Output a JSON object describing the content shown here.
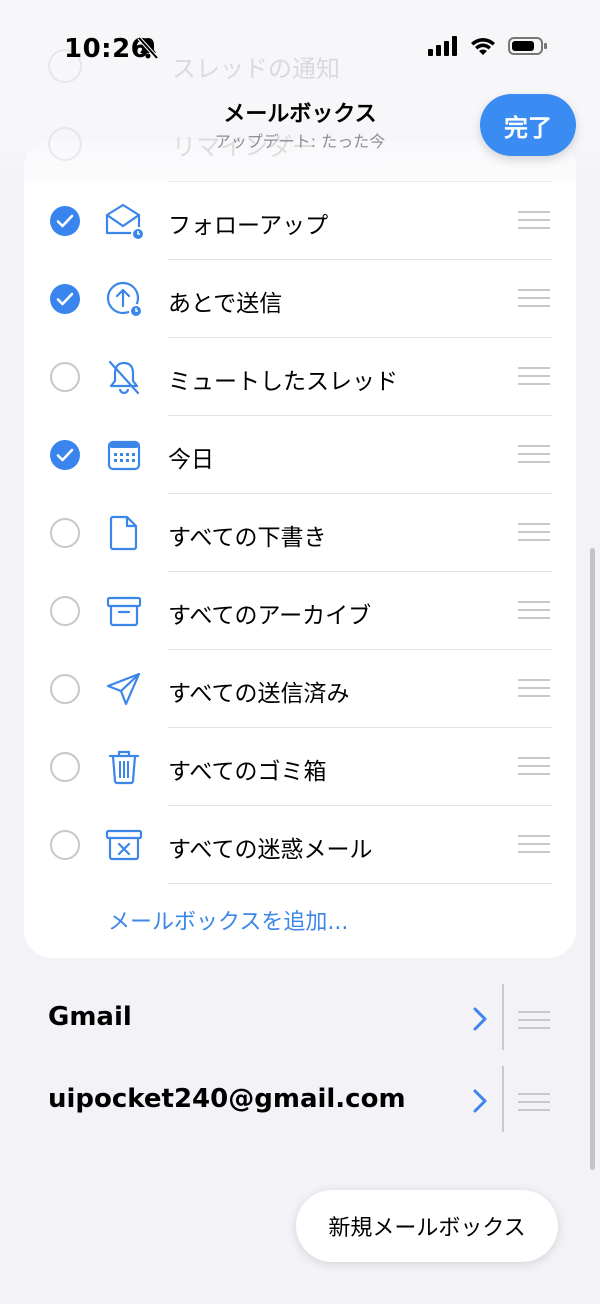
{
  "status": {
    "time": "10:26"
  },
  "header": {
    "title": "メールボックス",
    "subtitle": "アップデート: たった今",
    "done_label": "完了",
    "ghost_items": [
      "スレッドの通知",
      "リマインダー"
    ]
  },
  "colors": {
    "accent": "#3b8cf2",
    "check": "#3a84ee",
    "bg": "#f2f2f7"
  },
  "mailboxes": [
    {
      "label": "フォローアップ",
      "checked": true,
      "icon": "envelope-clock-icon"
    },
    {
      "label": "あとで送信",
      "checked": true,
      "icon": "send-later-icon"
    },
    {
      "label": "ミュートしたスレッド",
      "checked": false,
      "icon": "bell-slash-icon"
    },
    {
      "label": "今日",
      "checked": true,
      "icon": "calendar-icon"
    },
    {
      "label": "すべての下書き",
      "checked": false,
      "icon": "document-icon"
    },
    {
      "label": "すべてのアーカイブ",
      "checked": false,
      "icon": "archive-box-icon"
    },
    {
      "label": "すべての送信済み",
      "checked": false,
      "icon": "paper-plane-icon"
    },
    {
      "label": "すべてのゴミ箱",
      "checked": false,
      "icon": "trash-icon"
    },
    {
      "label": "すべての迷惑メール",
      "checked": false,
      "icon": "junk-box-icon"
    }
  ],
  "add_mailbox_label": "メールボックスを追加...",
  "accounts": [
    {
      "name": "Gmail"
    },
    {
      "name": "uipocket240@gmail.com"
    }
  ],
  "new_mailbox_label": "新規メールボックス"
}
